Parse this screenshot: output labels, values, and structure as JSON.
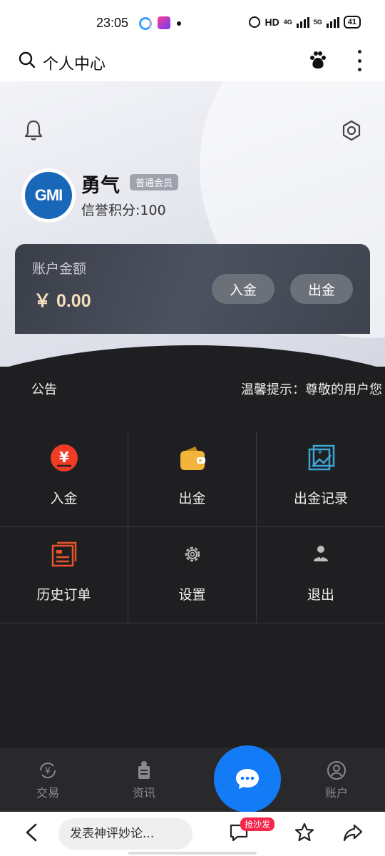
{
  "status_bar": {
    "time": "23:05",
    "network": "HD",
    "signal1": "4G",
    "signal2": "5G",
    "battery": "41"
  },
  "header": {
    "title": "个人中心"
  },
  "profile": {
    "avatar_text": "GMI",
    "name": "勇气",
    "badge": "普通会员",
    "credit": "信誉积分:100"
  },
  "account": {
    "label": "账户金额",
    "amount": "￥ 0.00",
    "deposit_label": "入金",
    "withdraw_label": "出金"
  },
  "notice": {
    "label": "公告",
    "text": "温馨提示：尊敬的用户您"
  },
  "menu": [
    {
      "label": "入金",
      "icon": "yuan-deposit-icon",
      "color": "#f03c24"
    },
    {
      "label": "出金",
      "icon": "wallet-icon",
      "color": "#f2b43a"
    },
    {
      "label": "出金记录",
      "icon": "record-chart-icon",
      "color": "#3aa7d6"
    },
    {
      "label": "历史订单",
      "icon": "order-list-icon",
      "color": "#e8552a"
    },
    {
      "label": "设置",
      "icon": "gear-icon",
      "color": "#bdbdbd"
    },
    {
      "label": "退出",
      "icon": "user-logout-icon",
      "color": "#bdbdbd"
    }
  ],
  "tabs": [
    {
      "label": "交易",
      "icon": "yuan-exchange-icon"
    },
    {
      "label": "资讯",
      "icon": "news-icon"
    },
    {
      "label": "账户",
      "icon": "account-icon"
    }
  ],
  "browser": {
    "comment_placeholder": "发表神评妙论...",
    "sofa_badge": "抢沙发"
  },
  "colors": {
    "accent_blue": "#137bf5",
    "amount_gold": "#f5dfbc",
    "dark_bg": "#1f1f21"
  }
}
